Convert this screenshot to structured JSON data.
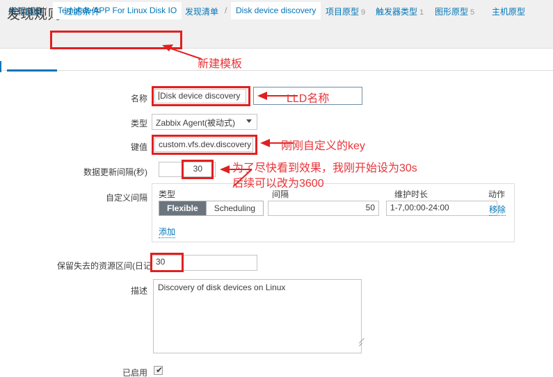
{
  "page": {
    "title": "发现规则"
  },
  "breadcrumb": {
    "items": [
      {
        "label": "所有模板",
        "style": "link"
      },
      {
        "label": "Template APP For Linux Disk IO",
        "style": "highlight"
      },
      {
        "label": "发现清单",
        "style": "link"
      },
      {
        "label": "Disk device discovery",
        "style": "current"
      }
    ],
    "separator": "/",
    "nav": [
      {
        "label": "项目原型",
        "count": "9"
      },
      {
        "label": "触发器类型",
        "count": "1"
      },
      {
        "label": "图形原型",
        "count": "5"
      },
      {
        "label": "主机原型",
        "count": ""
      }
    ]
  },
  "tabs": [
    {
      "label": "发现规则",
      "active": true
    },
    {
      "label": "过滤条件",
      "active": false
    }
  ],
  "form": {
    "name": {
      "label": "名称",
      "value": "Disk device discovery"
    },
    "type": {
      "label": "类型",
      "value": "Zabbix Agent(被动式)"
    },
    "key": {
      "label": "键值",
      "value": "custom.vfs.dev.discovery"
    },
    "update_interval": {
      "label": "数据更新间隔(秒)",
      "value": "30"
    },
    "custom_intervals": {
      "label": "自定义间隔",
      "headers": [
        "类型",
        "间隔",
        "维护时长",
        "动作"
      ],
      "rows": [
        {
          "type_options": [
            "Flexible",
            "Scheduling"
          ],
          "type_selected": "Flexible",
          "interval": "50",
          "period": "1-7,00:00-24:00",
          "action": "移除"
        }
      ],
      "add_label": "添加"
    },
    "keep_lost": {
      "label": "保留失去的资源区间(日记)",
      "value": "30"
    },
    "description": {
      "label": "描述",
      "value": "Discovery of disk devices on Linux"
    },
    "enabled": {
      "label": "已启用",
      "checked": true,
      "mark": "✔"
    }
  },
  "annotations": [
    {
      "id": "new-template",
      "text": "新建模板"
    },
    {
      "id": "lld-name",
      "text": "LLD名称"
    },
    {
      "id": "custom-key",
      "text": "刚刚自定义的key"
    },
    {
      "id": "interval-note-1",
      "text": "为了尽快看到效果，我刚开始设为30s"
    },
    {
      "id": "interval-note-2",
      "text": "后续可以改为3600"
    }
  ],
  "colors": {
    "annotation_red": "#e8353a",
    "link_blue": "#0275b8",
    "accent_blue": "#0275b8",
    "segment_active": "#6c757d"
  }
}
